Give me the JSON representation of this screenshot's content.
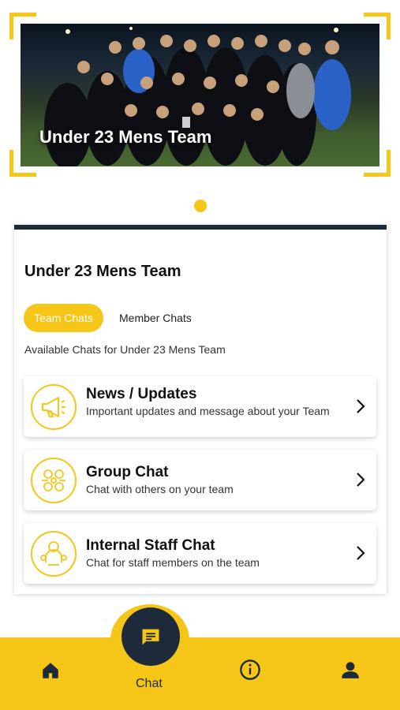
{
  "banner": {
    "title": "Under 23 Mens Team",
    "accent": "#F5C518"
  },
  "team": {
    "name": "Under 23 Mens Team",
    "tabs": {
      "team_chats": "Team Chats",
      "member_chats": "Member Chats",
      "active": "team_chats"
    },
    "available_text": "Available Chats for Under 23 Mens Team"
  },
  "chats": [
    {
      "title": "News / Updates",
      "desc": "Important updates and message about your Team",
      "icon": "megaphone-icon"
    },
    {
      "title": "Group Chat",
      "desc": "Chat with others on your team",
      "icon": "group-icon"
    },
    {
      "title": "Internal Staff Chat",
      "desc": "Chat for staff members on the team",
      "icon": "staff-icon"
    }
  ],
  "nav": {
    "chat_label": "Chat",
    "items": [
      "home-icon",
      "chat-icon",
      "info-icon",
      "profile-icon"
    ],
    "active": "chat-icon"
  },
  "colors": {
    "accent": "#F5C518",
    "navy": "#1d2a3a"
  }
}
